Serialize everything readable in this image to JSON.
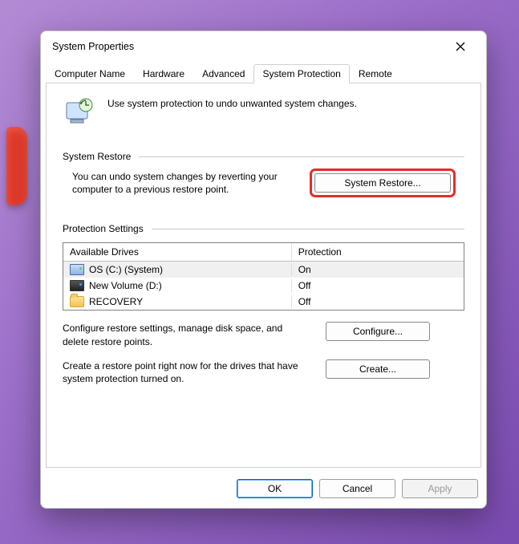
{
  "window": {
    "title": "System Properties"
  },
  "tabs": [
    {
      "label": "Computer Name"
    },
    {
      "label": "Hardware"
    },
    {
      "label": "Advanced"
    },
    {
      "label": "System Protection",
      "active": true
    },
    {
      "label": "Remote"
    }
  ],
  "intro": {
    "text": "Use system protection to undo unwanted system changes."
  },
  "sections": {
    "restore": {
      "heading": "System Restore",
      "description": "You can undo system changes by reverting your computer to a previous restore point.",
      "button_label": "System Restore..."
    },
    "protection": {
      "heading": "Protection Settings",
      "columns": {
        "drive": "Available Drives",
        "protection": "Protection"
      },
      "drives": [
        {
          "icon": "disk-blue",
          "name": "OS (C:) (System)",
          "protection": "On",
          "selected": true
        },
        {
          "icon": "disk-dark",
          "name": "New Volume (D:)",
          "protection": "Off"
        },
        {
          "icon": "folder",
          "name": "RECOVERY",
          "protection": "Off"
        }
      ],
      "configure": {
        "text": "Configure restore settings, manage disk space, and delete restore points.",
        "button_label": "Configure..."
      },
      "create": {
        "text": "Create a restore point right now for the drives that have system protection turned on.",
        "button_label": "Create..."
      }
    }
  },
  "dialog_buttons": {
    "ok": "OK",
    "cancel": "Cancel",
    "apply": "Apply"
  }
}
